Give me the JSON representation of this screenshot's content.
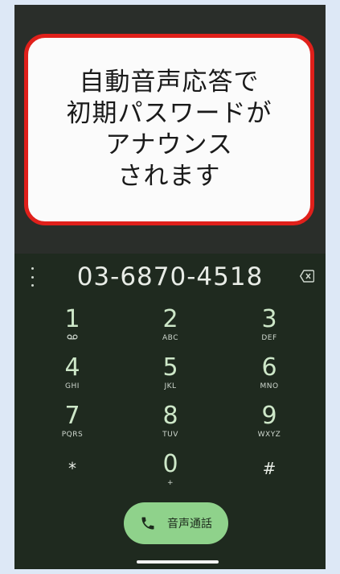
{
  "callout": {
    "line1": "自動音声応答で",
    "line2": "初期パスワードが",
    "line3": "アナウンス",
    "line4": "されます"
  },
  "dialer": {
    "number": "03-6870-4518",
    "keys": [
      {
        "digit": "1",
        "letters": ""
      },
      {
        "digit": "2",
        "letters": "ABC"
      },
      {
        "digit": "3",
        "letters": "DEF"
      },
      {
        "digit": "4",
        "letters": "GHI"
      },
      {
        "digit": "5",
        "letters": "JKL"
      },
      {
        "digit": "6",
        "letters": "MNO"
      },
      {
        "digit": "7",
        "letters": "PQRS"
      },
      {
        "digit": "8",
        "letters": "TUV"
      },
      {
        "digit": "9",
        "letters": "WXYZ"
      },
      {
        "digit": "*",
        "letters": ""
      },
      {
        "digit": "0",
        "letters": "+"
      },
      {
        "digit": "#",
        "letters": ""
      }
    ],
    "call_label": "音声通話"
  },
  "colors": {
    "callout_border": "#e0201b",
    "call_button": "#8fd28b",
    "digit": "#cde7c8"
  },
  "icons": [
    "more-vert-icon",
    "backspace-icon",
    "voicemail-icon",
    "phone-icon"
  ]
}
